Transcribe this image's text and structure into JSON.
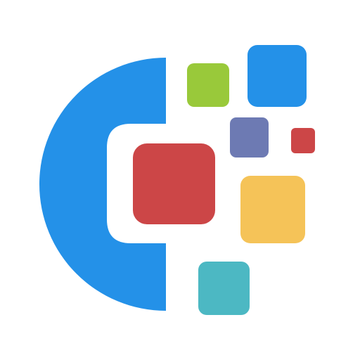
{
  "logo": {
    "icon": "app-logo-icon",
    "colors": {
      "background": "#ffffff",
      "arc": "#2491e8",
      "large_square": "#cc4647",
      "green_square": "#99c93a",
      "top_blue_square": "#2491e8",
      "purple_square": "#6d7ab3",
      "small_red_square": "#cc4647",
      "yellow_square": "#f5c358",
      "teal_square": "#4cb8c3"
    }
  }
}
